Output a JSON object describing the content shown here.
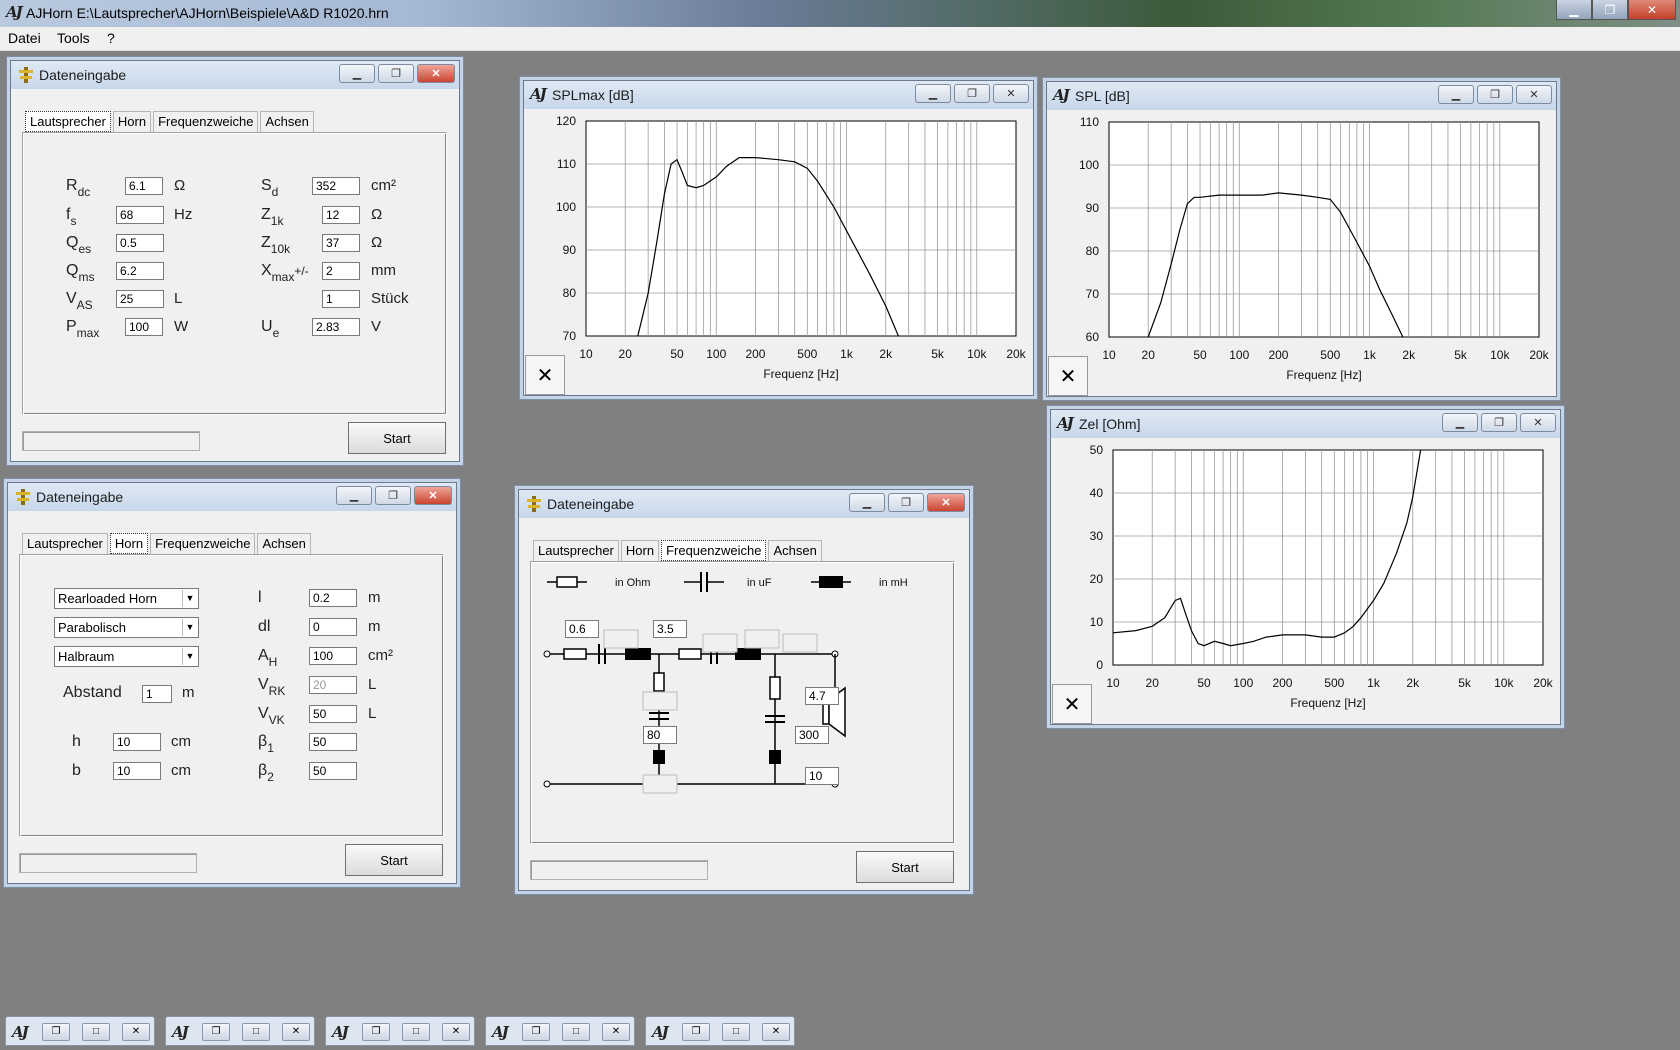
{
  "app": {
    "logo": "AJ",
    "title": "AJHorn  E:\\Lautsprecher\\AJHorn\\Beispiele\\A&D R1020.hrn"
  },
  "menu": [
    "Datei",
    "Tools",
    "?"
  ],
  "colors": {
    "desktop": "#808080",
    "window_bg": "#f0f0f0",
    "close_red": "#c2402a",
    "title_blue": "#c7d7ea"
  },
  "tabs": [
    "Lautsprecher",
    "Horn",
    "Frequenzweiche",
    "Achsen"
  ],
  "start_label": "Start",
  "win1": {
    "title": "Dateneingabe",
    "left": {
      "rdc": {
        "main": "R",
        "sub": "dc",
        "value": "6.1",
        "unit": "Ω"
      },
      "fs": {
        "main": "f",
        "sub": "s",
        "value": "68",
        "unit": "Hz"
      },
      "qes": {
        "main": "Q",
        "sub": "es",
        "value": "0.5"
      },
      "qms": {
        "main": "Q",
        "sub": "ms",
        "value": "6.2"
      },
      "vas": {
        "main": "V",
        "sub": "AS",
        "value": "25",
        "unit": "L"
      },
      "pmax": {
        "main": "P",
        "sub": "max",
        "value": "100",
        "unit": "W"
      }
    },
    "right": {
      "sd": {
        "main": "S",
        "sub": "d",
        "value": "352",
        "unit": "cm²"
      },
      "z1k": {
        "main": "Z",
        "sub": "1k",
        "value": "12",
        "unit": "Ω"
      },
      "z10k": {
        "main": "Z",
        "sub": "10k",
        "value": "37",
        "unit": "Ω"
      },
      "xmax": {
        "main": "X",
        "sub": "max",
        "suffix": "+/-",
        "value": "2",
        "unit": "mm"
      },
      "count": {
        "value": "1",
        "unit": "Stück"
      },
      "ue": {
        "main": "U",
        "sub": "e",
        "value": "2.83",
        "unit": "V"
      }
    }
  },
  "win2": {
    "title": "Dateneingabe",
    "selects": [
      "Rearloaded Horn",
      "Parabolisch",
      "Halbraum"
    ],
    "abstand": {
      "label": "Abstand",
      "value": "1",
      "unit": "m"
    },
    "h": {
      "label": "h",
      "value": "10",
      "unit": "cm"
    },
    "b": {
      "label": "b",
      "value": "10",
      "unit": "cm"
    },
    "l": {
      "label": "l",
      "value": "0.2",
      "unit": "m"
    },
    "dl": {
      "label": "dl",
      "value": "0",
      "unit": "m"
    },
    "ah": {
      "main": "A",
      "sub": "H",
      "value": "100",
      "unit": "cm²"
    },
    "vrk": {
      "main": "V",
      "sub": "RK",
      "value": "20",
      "unit": "L"
    },
    "vvk": {
      "main": "V",
      "sub": "VK",
      "value": "50",
      "unit": "L"
    },
    "b1": {
      "main": "β",
      "sub": "1",
      "value": "50"
    },
    "b2": {
      "main": "β",
      "sub": "2",
      "value": "50"
    }
  },
  "win3": {
    "title": "Dateneingabe",
    "legend": {
      "resistor": "in Ohm",
      "capacitor": "in uF",
      "inductor": "in mH"
    },
    "values": {
      "r1": "0.6",
      "l1": "3.5",
      "c_shunt": "80",
      "r_shunt2": "4.7",
      "c_shunt2": "300",
      "r_out": "10"
    }
  },
  "chart_data": [
    {
      "type": "line",
      "title": "SPLmax [dB]",
      "xlabel": "Frequenz [Hz]",
      "ylabel": "",
      "xscale": "log",
      "xlim": [
        10,
        20000
      ],
      "ylim": [
        70,
        120
      ],
      "xticks": [
        10,
        20,
        50,
        100,
        200,
        500,
        1000,
        2000,
        5000,
        10000,
        20000
      ],
      "xticklabels": [
        "10",
        "20",
        "50",
        "100",
        "200",
        "500",
        "1k",
        "2k",
        "5k",
        "10k",
        "20k"
      ],
      "yticks": [
        70,
        80,
        90,
        100,
        110,
        120
      ],
      "series": [
        {
          "x": [
            25,
            30,
            35,
            40,
            45,
            50,
            55,
            60,
            70,
            80,
            100,
            120,
            150,
            200,
            300,
            400,
            500,
            600,
            800,
            1000,
            1500,
            2000,
            2500
          ],
          "y": [
            70,
            80,
            92,
            103,
            110,
            111,
            108,
            105,
            104.5,
            105,
            107,
            109.5,
            111.5,
            111.5,
            111,
            110.5,
            109,
            106,
            100,
            94.5,
            84.5,
            77,
            70
          ]
        }
      ]
    },
    {
      "type": "line",
      "title": "SPL [dB]",
      "xlabel": "Frequenz [Hz]",
      "ylabel": "",
      "xscale": "log",
      "xlim": [
        10,
        20000
      ],
      "ylim": [
        60,
        110
      ],
      "xticks": [
        10,
        20,
        50,
        100,
        200,
        500,
        1000,
        2000,
        5000,
        10000,
        20000
      ],
      "xticklabels": [
        "10",
        "20",
        "50",
        "100",
        "200",
        "500",
        "1k",
        "2k",
        "5k",
        "10k",
        "20k"
      ],
      "yticks": [
        60,
        70,
        80,
        90,
        100,
        110
      ],
      "series": [
        {
          "x": [
            20,
            25,
            30,
            35,
            40,
            45,
            50,
            70,
            100,
            150,
            200,
            300,
            400,
            500,
            600,
            800,
            1000,
            1200,
            1500,
            1800
          ],
          "y": [
            60,
            68,
            77,
            85,
            91,
            92.5,
            92.5,
            93,
            93,
            93,
            93.5,
            93,
            92.5,
            92,
            89,
            82,
            76.5,
            71,
            65,
            60
          ]
        }
      ]
    },
    {
      "type": "line",
      "title": "Zel [Ohm]",
      "xlabel": "Frequenz [Hz]",
      "ylabel": "",
      "xscale": "log",
      "xlim": [
        10,
        20000
      ],
      "ylim": [
        0,
        50
      ],
      "xticks": [
        10,
        20,
        50,
        100,
        200,
        500,
        1000,
        2000,
        5000,
        10000,
        20000
      ],
      "xticklabels": [
        "10",
        "20",
        "50",
        "100",
        "200",
        "500",
        "1k",
        "2k",
        "5k",
        "10k",
        "20k"
      ],
      "yticks": [
        0,
        10,
        20,
        30,
        40,
        50
      ],
      "series": [
        {
          "x": [
            10,
            15,
            20,
            25,
            30,
            33,
            36,
            40,
            45,
            50,
            60,
            70,
            80,
            100,
            120,
            150,
            200,
            300,
            400,
            500,
            600,
            700,
            800,
            1000,
            1200,
            1500,
            1800,
            2000,
            2300
          ],
          "y": [
            7.5,
            8,
            9,
            11,
            15,
            15.5,
            12,
            8,
            5,
            4.5,
            5.5,
            5,
            4.5,
            5,
            5.5,
            6.5,
            7,
            7,
            6.5,
            6.5,
            7.5,
            9,
            11,
            15,
            19,
            26,
            33,
            39,
            50
          ]
        }
      ]
    }
  ],
  "taskbar_count": 5
}
